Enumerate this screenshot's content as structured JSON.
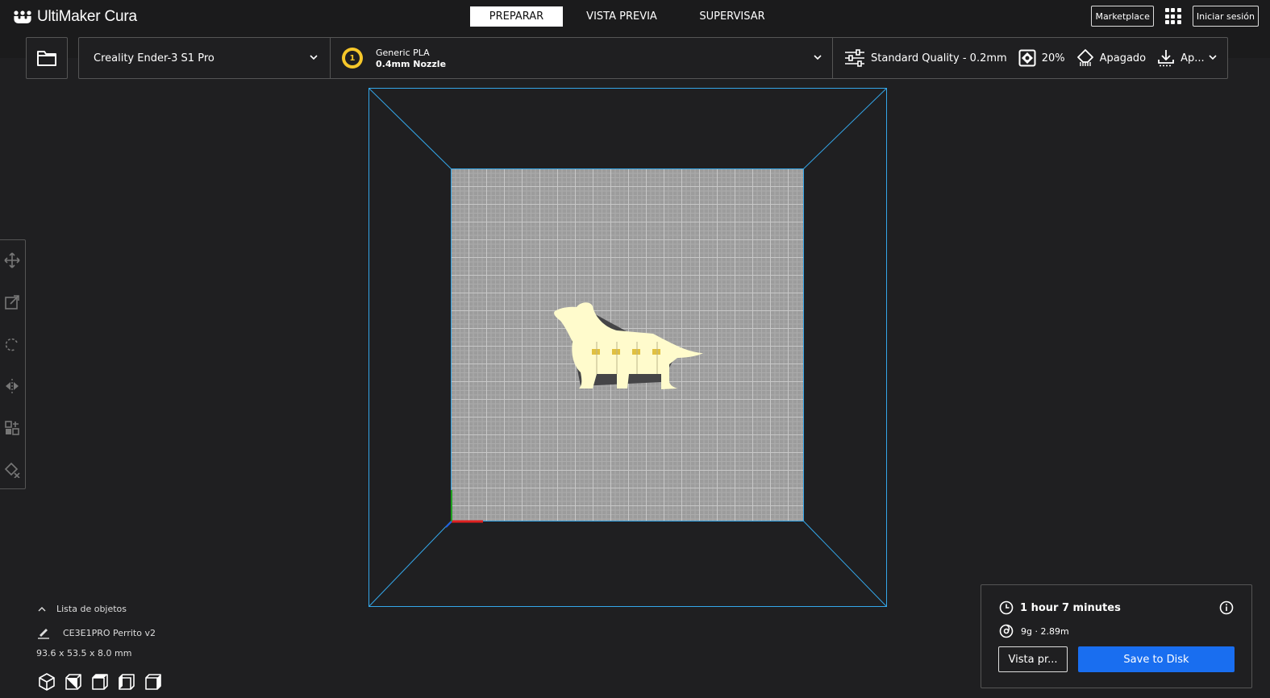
{
  "app": {
    "title": "UltiMaker Cura"
  },
  "header": {
    "tabs": [
      {
        "label": "PREPARAR",
        "active": true
      },
      {
        "label": "VISTA PREVIA",
        "active": false
      },
      {
        "label": "SUPERVISAR",
        "active": false
      }
    ],
    "marketplace_label": "Marketplace",
    "signin_label": "Iniciar sesión"
  },
  "toolbar": {
    "printer": "Creality Ender-3 S1 Pro",
    "extruder_number": "1",
    "material": "Generic PLA",
    "nozzle": "0.4mm Nozzle",
    "quality": "Standard Quality - 0.2mm",
    "infill": "20%",
    "support": "Apagado",
    "adhesion": "Ap..."
  },
  "object_list": {
    "header_label": "Lista de objetos",
    "object_name": "CE3E1PRO Perrito v2",
    "dimensions": "93.6 x 53.5 x 8.0 mm"
  },
  "print_summary": {
    "time": "1 hour 7 minutes",
    "material_usage": "9g · 2.89m",
    "preview_button": "Vista pr...",
    "save_button": "Save to Disk"
  },
  "colors": {
    "accent_blue": "#196ef0",
    "build_volume_outline": "#34a6e8",
    "model_color": "#fffbcc",
    "material_badge": "#f6c72a",
    "background": "#1f1f21"
  },
  "icons": {
    "left_tools": [
      "move-icon",
      "scale-icon",
      "rotate-icon",
      "mirror-icon",
      "per-model-settings-icon",
      "support-blocker-icon"
    ],
    "view_modes": [
      "3d-view-icon",
      "front-view-icon",
      "top-view-icon",
      "left-view-icon",
      "right-view-icon"
    ]
  }
}
